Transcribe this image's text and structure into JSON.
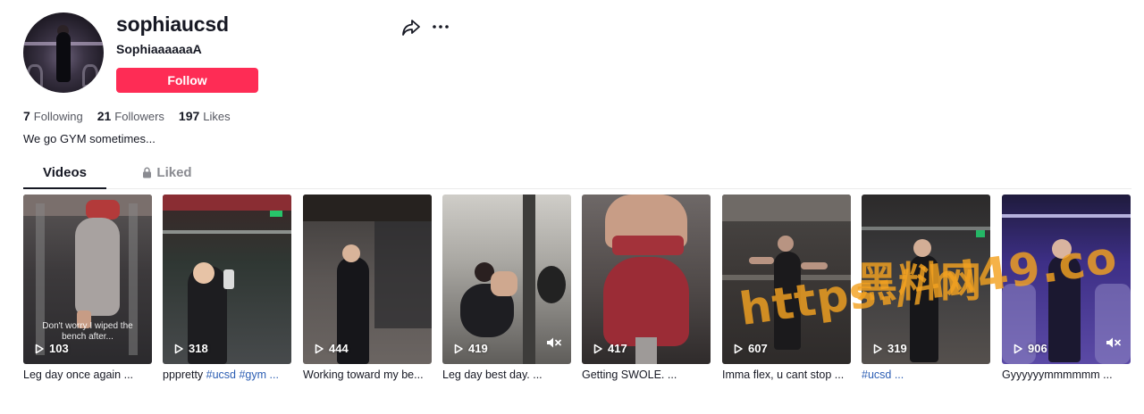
{
  "profile": {
    "username": "sophiaucsd",
    "nickname": "SophiaaaaaaA",
    "follow_label": "Follow",
    "bio": "We go GYM sometimes..."
  },
  "actions": {
    "share_icon": "share-icon",
    "more_icon": "more-icon"
  },
  "stats": {
    "following_count": "7",
    "following_label": "Following",
    "followers_count": "21",
    "followers_label": "Followers",
    "likes_count": "197",
    "likes_label": "Likes"
  },
  "tabs": {
    "videos": "Videos",
    "liked": "Liked"
  },
  "colors": {
    "follow": "#fe2c55",
    "hashtag": "#2b5db3",
    "watermark": "#f3a221"
  },
  "videos": [
    {
      "views": "103",
      "caption_text": "Leg day once again ...",
      "overlay": "Don't worry I wiped the bench after..."
    },
    {
      "views": "318",
      "caption_text": "pppretty ",
      "caption_tags": "#ucsd #gym ...",
      "overlay": ""
    },
    {
      "views": "444",
      "caption_text": "Working toward my be...",
      "overlay": ""
    },
    {
      "views": "419",
      "caption_text": "Leg day best day. ...",
      "overlay": "",
      "muted": true
    },
    {
      "views": "417",
      "caption_text": "Getting SWOLE. ...",
      "overlay": ""
    },
    {
      "views": "607",
      "caption_text": "Imma flex, u cant stop ...",
      "overlay": ""
    },
    {
      "views": "319",
      "caption_text": "",
      "caption_tags": "#ucsd ...",
      "overlay": ""
    },
    {
      "views": "906",
      "caption_text": "Gyyyyyymmmmmm ...",
      "overlay": "",
      "muted": true
    }
  ],
  "watermark": {
    "cjk": "黑料网",
    "url": "https://hl49.co"
  }
}
